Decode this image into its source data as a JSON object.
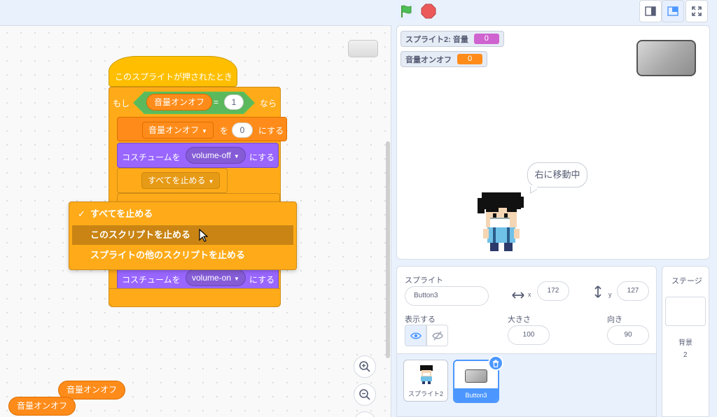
{
  "code": {
    "hat_label": "このスプライトが押されたとき",
    "if_label": "もし",
    "then_label": "なら",
    "cond_var": "音量オンオフ",
    "cond_op": "=",
    "cond_value": "1",
    "set_var_dropdown": "音量オンオフ",
    "set_to_label": "を",
    "set_value": "0",
    "set_suffix": "にする",
    "costume_label": "コスチュームを",
    "costume_value_off": "volume-off",
    "costume_suffix": "にする",
    "stop_dropdown": "すべてを止める",
    "costume_value_on": "volume-on"
  },
  "stop_menu": {
    "items": [
      {
        "label": "すべてを止める",
        "checked": true
      },
      {
        "label": "このスクリプトを止める",
        "checked": false
      },
      {
        "label": "スプライトの他のスクリプトを止める",
        "checked": false
      }
    ],
    "check_mark": "✓"
  },
  "floating_reporters": [
    "音量オンオフ",
    "音量オンオフ"
  ],
  "monitors": [
    {
      "label": "スプライト2: 音量",
      "value": "0",
      "color": "#cf63cf"
    },
    {
      "label": "音量オンオフ",
      "value": "0",
      "color": "#ff8c1a"
    }
  ],
  "stage": {
    "speech": "右に移動中"
  },
  "sprite_info": {
    "sprite_label": "スプライト",
    "sprite_name": "Button3",
    "x_label": "x",
    "x_value": "172",
    "y_label": "y",
    "y_value": "127",
    "show_label": "表示する",
    "size_label": "大きさ",
    "size_value": "100",
    "direction_label": "向き",
    "direction_value": "90"
  },
  "sprites": [
    {
      "name": "スプライト2",
      "selected": false
    },
    {
      "name": "Button3",
      "selected": true
    }
  ],
  "stage_panel": {
    "title": "ステージ",
    "backdrop_label": "背景",
    "backdrop_count": "2"
  },
  "colors": {
    "control": "#ffab19",
    "events": "#ffbf00",
    "variables": "#ff8c1a",
    "looks": "#9966ff",
    "operators": "#59c059",
    "accent": "#4c97ff"
  }
}
